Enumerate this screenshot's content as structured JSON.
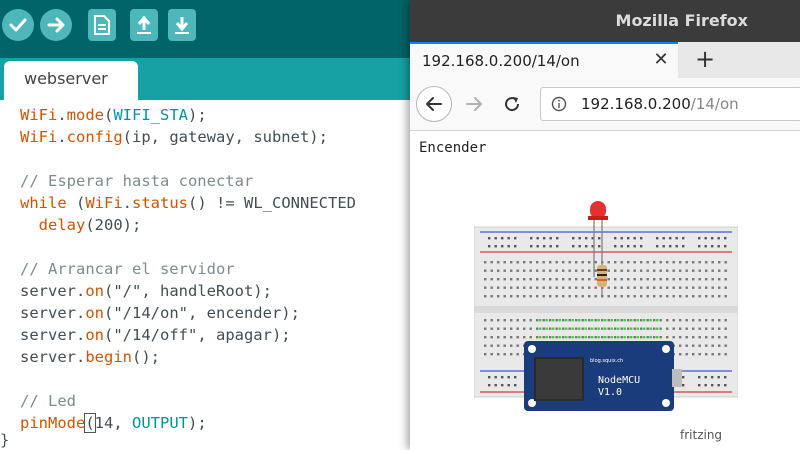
{
  "ide": {
    "tab_name": "webserver",
    "code_lines": [
      [
        {
          "t": "WiFi",
          "c": "kw"
        },
        {
          "t": "."
        },
        {
          "t": "mode",
          "c": "kw"
        },
        {
          "t": "("
        },
        {
          "t": "WIFI_STA",
          "c": "cl"
        },
        {
          "t": ");"
        }
      ],
      [
        {
          "t": "WiFi",
          "c": "kw"
        },
        {
          "t": "."
        },
        {
          "t": "config",
          "c": "kw"
        },
        {
          "t": "(ip, gateway, subnet);"
        }
      ],
      [],
      [
        {
          "t": "// Esperar hasta conectar",
          "c": "cm"
        }
      ],
      [
        {
          "t": "while",
          "c": "kw"
        },
        {
          "t": " ("
        },
        {
          "t": "WiFi",
          "c": "kw"
        },
        {
          "t": "."
        },
        {
          "t": "status",
          "c": "kw"
        },
        {
          "t": "() != WL_CONNECTED"
        }
      ],
      [
        {
          "t": "  "
        },
        {
          "t": "delay",
          "c": "kw"
        },
        {
          "t": "(200);"
        }
      ],
      [],
      [
        {
          "t": "// Arrancar el servidor",
          "c": "cm"
        }
      ],
      [
        {
          "t": "server."
        },
        {
          "t": "on",
          "c": "kw"
        },
        {
          "t": "(\"/\", handleRoot);"
        }
      ],
      [
        {
          "t": "server."
        },
        {
          "t": "on",
          "c": "kw"
        },
        {
          "t": "(\"/14/on\", encender);"
        }
      ],
      [
        {
          "t": "server."
        },
        {
          "t": "on",
          "c": "kw"
        },
        {
          "t": "(\"/14/off\", apagar);"
        }
      ],
      [
        {
          "t": "server."
        },
        {
          "t": "begin",
          "c": "kw"
        },
        {
          "t": "();"
        }
      ],
      [],
      [
        {
          "t": "// Led",
          "c": "cm"
        }
      ],
      [
        {
          "t": "pinMode",
          "c": "kw"
        },
        {
          "t": "(",
          "box": true
        },
        {
          "t": "14, "
        },
        {
          "t": "OUTPUT",
          "c": "cl"
        },
        {
          "t": ");"
        }
      ]
    ],
    "closing_brace": "}"
  },
  "firefox": {
    "window_title": "Mozilla Firefox",
    "tab_title": "192.168.0.200/14/on",
    "url_host": "192.168.0.200",
    "url_path": "/14/on",
    "page_text": "Encender",
    "board_silkscreen_1": "NodeMCU",
    "board_silkscreen_2": "V1.0",
    "board_small_text": "blog.squix.ch",
    "fritzing_label": "fritzing"
  },
  "colors": {
    "ide_toolbar": "#006468",
    "ide_tabstrip": "#17a1a5",
    "ide_button": "#4db7bb",
    "keyword": "#d35400",
    "constant": "#00979c",
    "comment": "#7f8c8d",
    "ff_titlebar": "#3b3b3b",
    "ff_tab_accent": "#0a84ff",
    "board_blue": "#1b3c7a",
    "led_red": "#e53030"
  },
  "icons": {
    "verify": "checkmark-icon",
    "upload": "arrow-right-icon",
    "new": "new-file-icon",
    "open": "open-arrow-up-icon",
    "save": "save-arrow-down-icon",
    "back": "arrow-left-icon",
    "forward": "arrow-right-icon",
    "reload": "reload-icon",
    "info": "info-icon"
  }
}
